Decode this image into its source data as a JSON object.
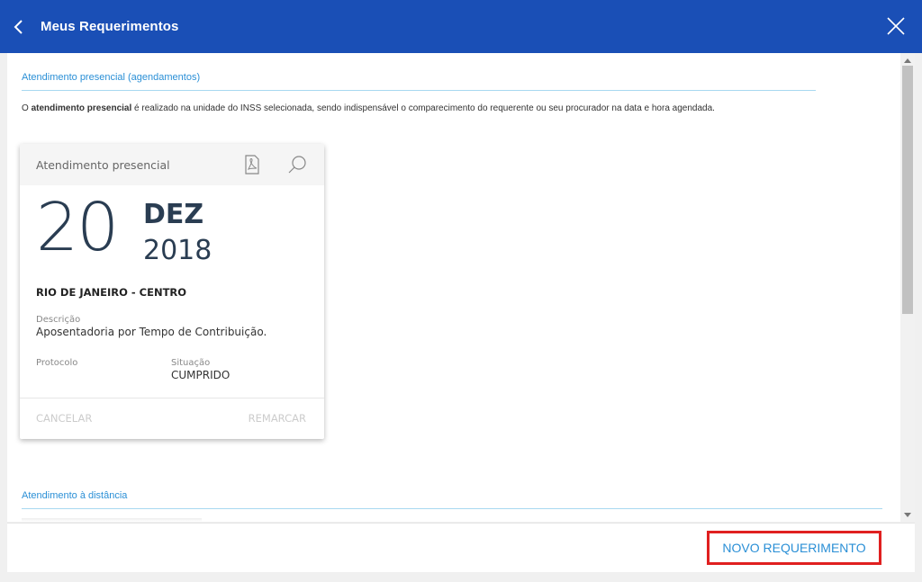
{
  "header": {
    "title": "Meus Requerimentos",
    "back_icon": "chevron-left-icon",
    "close_icon": "close-icon"
  },
  "section_presencial": {
    "title": "Atendimento presencial (agendamentos)",
    "intro_before": "O ",
    "intro_bold": "atendimento presencial",
    "intro_after": " é realizado na unidade do INSS selecionada, sendo indispensável o comparecimento do requerente ou seu procurador na data e hora agendada."
  },
  "card": {
    "title": "Atendimento presencial",
    "pdf_icon": "pdf-icon",
    "search_icon": "search-icon",
    "day": "20",
    "month": "DEZ",
    "year": "2018",
    "unit": "RIO DE JANEIRO - CENTRO",
    "descricao_label": "Descrição",
    "descricao_value": "Aposentadoria por Tempo de Contribuição.",
    "protocolo_label": "Protocolo",
    "situacao_label": "Situação",
    "situacao_value": "CUMPRIDO",
    "cancel_label": "CANCELAR",
    "reschedule_label": "REMARCAR"
  },
  "section_distancia": {
    "title": "Atendimento à distância"
  },
  "footer": {
    "novo_label": "NOVO REQUERIMENTO"
  },
  "colors": {
    "header_bg": "#1a4fb6",
    "accent": "#2a8fd6",
    "highlight_border": "#e02020"
  }
}
